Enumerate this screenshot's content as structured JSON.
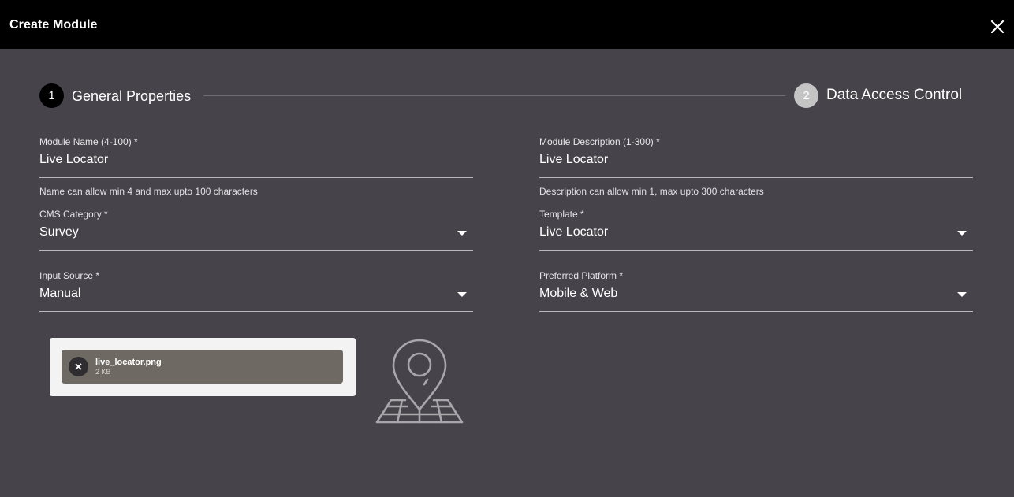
{
  "header": {
    "title": "Create Module",
    "close_icon": "close-icon"
  },
  "stepper": {
    "steps": [
      {
        "number": "1",
        "label": "General Properties",
        "state": "active"
      },
      {
        "number": "2",
        "label": "Data Access Control",
        "state": "inactive"
      }
    ]
  },
  "form": {
    "module_name": {
      "label": "Module Name (4-100) *",
      "value": "Live Locator",
      "hint": "Name can allow min 4 and max upto 100 characters"
    },
    "module_description": {
      "label": "Module Description (1-300) *",
      "value": "Live Locator",
      "hint": "Description can allow min 1, max upto 300 characters"
    },
    "cms_category": {
      "label": "CMS Category *",
      "value": "Survey"
    },
    "template": {
      "label": "Template *",
      "value": "Live Locator"
    },
    "input_source": {
      "label": "Input Source *",
      "value": "Manual"
    },
    "preferred_platform": {
      "label": "Preferred Platform *",
      "value": "Mobile & Web"
    }
  },
  "upload": {
    "file_name": "live_locator.png",
    "file_size": "2 KB",
    "preview_icon": "map-pin-icon"
  },
  "colors": {
    "background": "#46434a",
    "header": "#000000",
    "active_step": "#000000",
    "inactive_step": "#c4c4c4",
    "file_chip": "#6e6963"
  }
}
